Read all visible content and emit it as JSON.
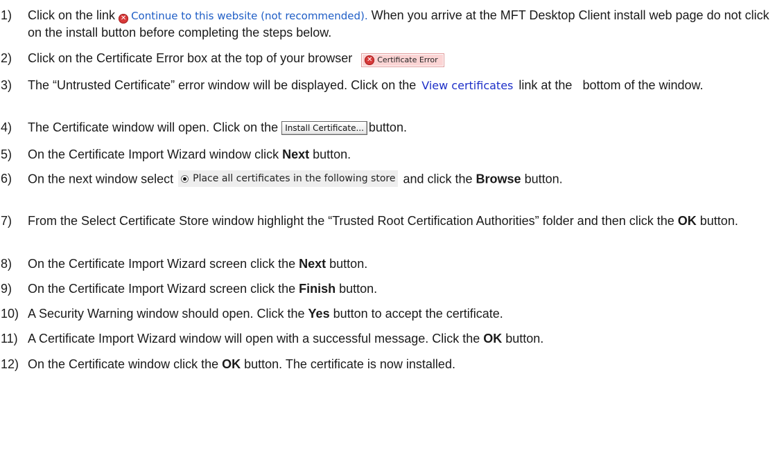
{
  "steps": [
    {
      "num": "1)",
      "pre": "Click on the link",
      "link_text": "Continue to this website (not recommended).",
      "post": " When you arrive at the MFT Desktop Client install web page do not click on the install button before completing the steps below."
    },
    {
      "num": "2)",
      "pre": "Click on the Certificate Error box at the top of your browser",
      "badge_text": "Certificate Error"
    },
    {
      "num": "3)",
      "pre": "The “Untrusted Certificate” error window will be displayed. Click on the",
      "link_text": "View certificates",
      "post": "link at the   bottom of the window."
    },
    {
      "num": "4)",
      "pre": "The Certificate window will open. Click on the",
      "button_text": "Install Certificate...",
      "post": "button."
    },
    {
      "num": "5)",
      "pre": "On the Certificate Import Wizard window click ",
      "bold": "Next",
      "post": " button."
    },
    {
      "num": "6)",
      "pre": "On the next window select",
      "radio_text": "Place all certificates in the following store",
      "mid": "and click the ",
      "bold": "Browse",
      "post": " button."
    },
    {
      "num": "7)",
      "pre": "From the Select Certificate Store window highlight the “Trusted Root Certification Authorities” folder and then click the ",
      "bold": "OK",
      "post": " button."
    },
    {
      "num": "8)",
      "pre": "On the Certificate Import Wizard screen click the ",
      "bold": "Next",
      "post": " button."
    },
    {
      "num": "9)",
      "pre": "On the Certificate Import Wizard screen click the ",
      "bold": "Finish",
      "post": " button."
    },
    {
      "num": "10)",
      "pre": "A Security Warning window should open. Click the ",
      "bold": "Yes",
      "post": " button to accept the certificate."
    },
    {
      "num": "11)",
      "pre": "A Certificate Import Wizard window will open with a successful message. Click the ",
      "bold": "OK",
      "post": " button."
    },
    {
      "num": "12)",
      "pre": "On the Certificate window click the ",
      "bold": "OK",
      "post": " button. The certificate is now installed."
    }
  ],
  "icons": {
    "shield_glyph": "✕"
  },
  "colors": {
    "link_blue": "#1f5ec6",
    "view_link_blue": "#1d2fc8",
    "error_red": "#d83a3a",
    "badge_bg": "#fbd4d4"
  }
}
